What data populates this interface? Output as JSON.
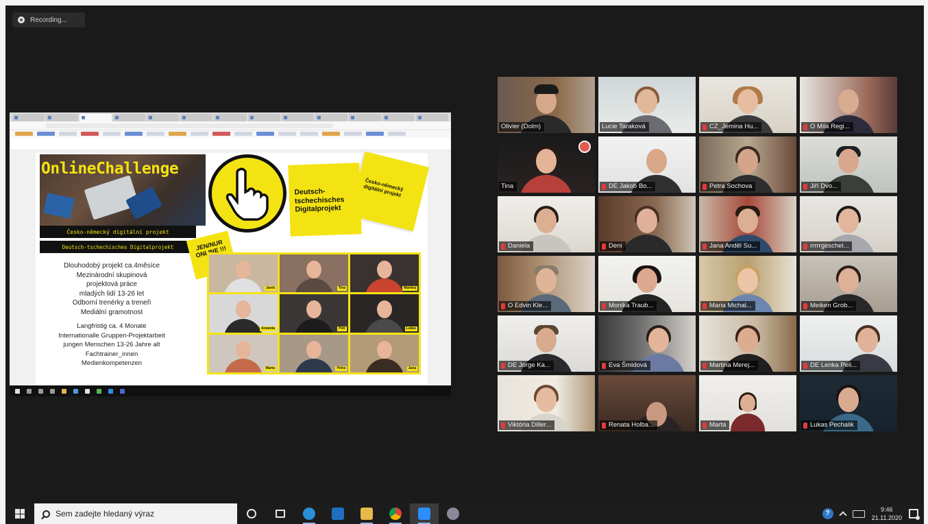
{
  "recording": {
    "label": "Recording..."
  },
  "shared_screen": {
    "slide": {
      "title": "OnlineChallenge",
      "bar_cz": "Česko-německý digitální projekt",
      "bar_de": "Deutsch-tschechisches Digitalprojekt",
      "note_de": "Deutsch-tschechisches Digitalprojekt",
      "note_cz": "Česko-německý digitální projekt",
      "online_tag": "JEN/NUR ONLINE !!!",
      "text_cz": [
        "Dlouhodobý projekt ca.4měsíce",
        "Mezinárodní skupinová",
        "projektová práce",
        "mladých lidí 13-26 let",
        "Odborní trenérky a treneři",
        "Mediální gramotnost"
      ],
      "text_de": [
        "Langfristig ca. 4 Monate",
        "Internationalle Gruppen-Projektarbeit",
        "jungen Menschen 13-26 Jahre alt",
        "Fachtrainer_innen",
        "Medienkompetenzen"
      ],
      "collage_labels": [
        "Jarek",
        "Tina",
        "Martina",
        "Amanda",
        "Petr",
        "Lukas",
        "Marta",
        "Petra",
        "Jana"
      ]
    }
  },
  "participants": [
    {
      "name": "Olivier (Dolm)",
      "muted": false
    },
    {
      "name": "Lucie Taraková",
      "muted": false
    },
    {
      "name": "CZ_Jemina Hu...",
      "muted": true
    },
    {
      "name": "O Mila Regi...",
      "muted": true
    },
    {
      "name": "Tina",
      "muted": false,
      "active": true
    },
    {
      "name": "DE Jakob Bo...",
      "muted": true
    },
    {
      "name": "Petra Sochova",
      "muted": true
    },
    {
      "name": "Jiří Dvo...",
      "muted": true
    },
    {
      "name": "Daniela",
      "muted": true
    },
    {
      "name": "Deni",
      "muted": true
    },
    {
      "name": "Jana Anděl Su...",
      "muted": true
    },
    {
      "name": "rrrrrgeschel...",
      "muted": true
    },
    {
      "name": "O Edvin Kle...",
      "muted": true
    },
    {
      "name": "Monika Traub...",
      "muted": true
    },
    {
      "name": "Maria Michal...",
      "muted": true
    },
    {
      "name": "Meiken Grob...",
      "muted": true
    },
    {
      "name": "DE Jorge Ka...",
      "muted": true
    },
    {
      "name": "Eva Šmidová",
      "muted": true
    },
    {
      "name": "Martina Merej...",
      "muted": true
    },
    {
      "name": "DE Lenka Peli...",
      "muted": true
    },
    {
      "name": "Viktória Diller...",
      "muted": true
    },
    {
      "name": "Renata Holba...",
      "muted": true
    },
    {
      "name": "Marta",
      "muted": true
    },
    {
      "name": "Lukas Pechalik",
      "muted": true
    }
  ],
  "taskbar": {
    "search_placeholder": "Sem zadejte hledaný výraz",
    "apps": [
      "edge-icon",
      "mail-icon",
      "file-explorer-icon",
      "chrome-icon",
      "zoom-icon",
      "settings-icon"
    ],
    "clock_time": "9:46",
    "clock_date": "21.11.2020"
  },
  "colors": {
    "accent_yellow": "#f4e312",
    "zoom_active_border": "#e8d35a",
    "mute_red": "#e23a3a"
  }
}
